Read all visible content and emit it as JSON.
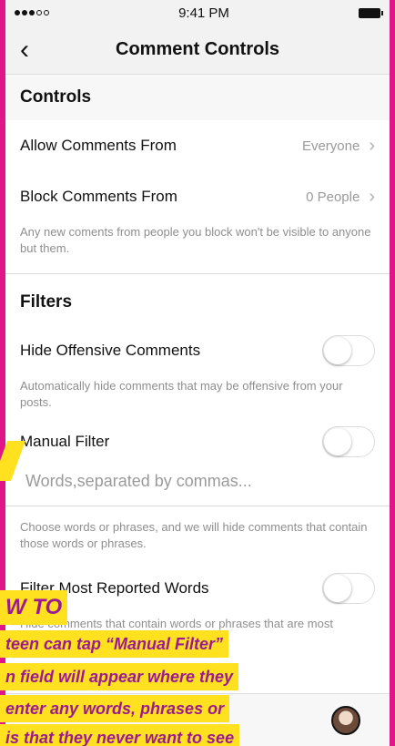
{
  "status": {
    "time": "9:41 PM"
  },
  "nav": {
    "title": "Comment Controls"
  },
  "controls": {
    "heading": "Controls",
    "allow_label": "Allow Comments From",
    "allow_value": "Everyone",
    "block_label": "Block Comments From",
    "block_value": "0 People",
    "block_note": "Any new coments from people you block won't be visible to anyone but them."
  },
  "filters": {
    "heading": "Filters",
    "offensive_label": "Hide Offensive Comments",
    "offensive_note": "Automatically hide comments that may be offensive from your posts.",
    "manual_label": "Manual Filter",
    "manual_placeholder": "Words,separated by commas...",
    "manual_note": "Choose words or phrases, and we will hide comments that contain those words or phrases.",
    "reported_label": "Filter Most Reported Words",
    "reported_note": "Hide comments that contain words or phrases that are most commonly reported on your posts."
  },
  "overlay": {
    "howto": "W TO",
    "line1": "teen can tap “Manual Filter”",
    "line2": "n field will appear where they",
    "line3": "enter any words, phrases or",
    "line4": "is that they never want to see"
  },
  "icons": {
    "back": "chevron-left-icon",
    "chevron": "chevron-right-icon",
    "profile": "profile-avatar-icon"
  }
}
